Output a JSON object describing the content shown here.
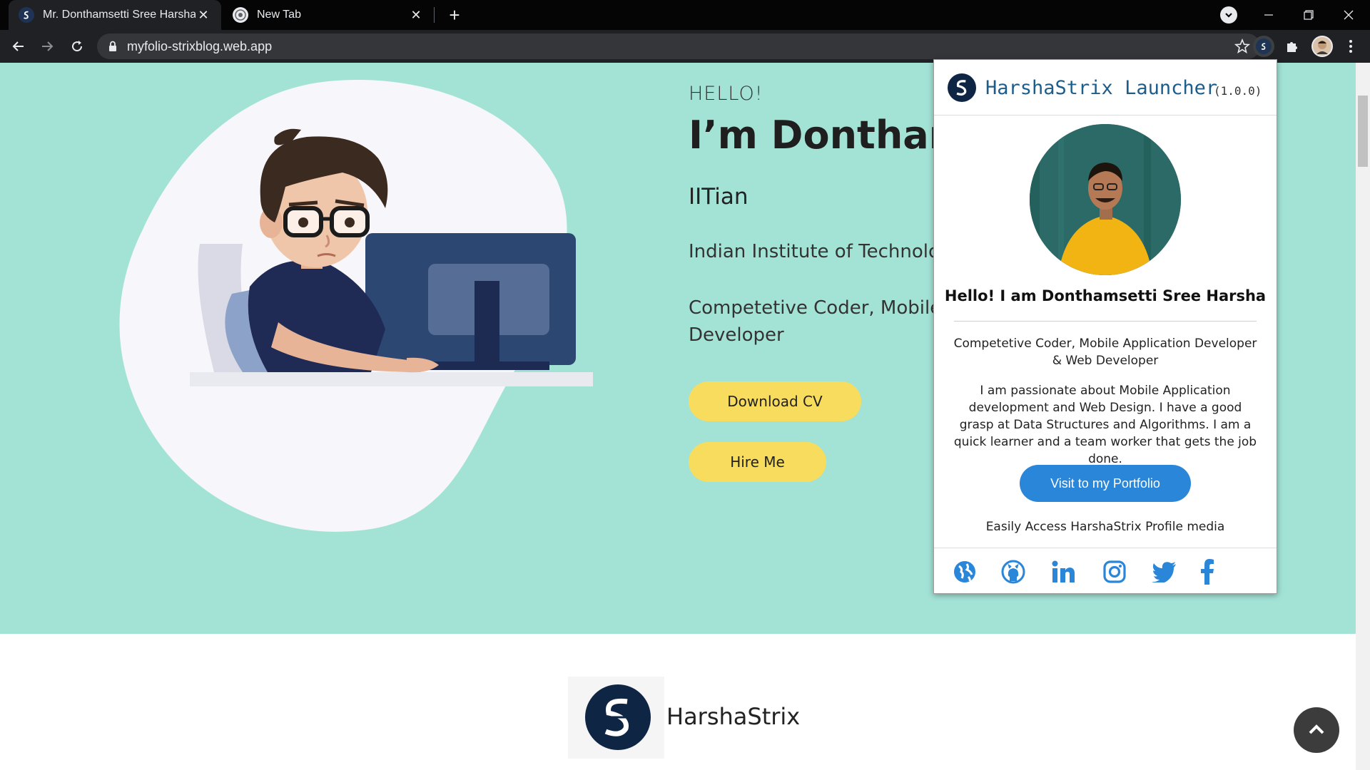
{
  "browser": {
    "tabs": [
      {
        "title": "Mr. Donthamsetti Sree Harsha",
        "active": true
      },
      {
        "title": "New Tab",
        "active": false
      }
    ],
    "url": "myfolio-strixblog.web.app"
  },
  "hero": {
    "greeting": "HELLO!",
    "name": "I’m Donthams",
    "role": "IITian",
    "institute": "Indian Institute of Technology",
    "description": "Competetive Coder, Mobile Ap Developer",
    "download_cv_label": "Download CV",
    "hire_me_label": "Hire Me"
  },
  "brand": {
    "name": "HarshaStrix"
  },
  "popup": {
    "title": "HarshaStrix Launcher",
    "version": "(1.0.0)",
    "hello": "Hello! I am Donthamsetti Sree Harsha",
    "roles": "Competetive Coder, Mobile Application Developer & Web Developer",
    "about": "I am passionate about Mobile Application development and Web Design. I have a good grasp at Data Structures and Algorithms. I am a quick learner and a team worker that gets the job done.",
    "portfolio_button_label": "Visit to my Portfolio",
    "access_text": "Easily Access HarshaStrix Profile media",
    "social_icons": [
      "globe-icon",
      "github-icon",
      "linkedin-icon",
      "instagram-icon",
      "twitter-icon",
      "facebook-icon"
    ]
  },
  "colors": {
    "hero_bg": "#a3e3d6",
    "cta_yellow": "#f7dc5d",
    "popup_accent": "#2a86d8",
    "brand_navy": "#0f2544"
  }
}
